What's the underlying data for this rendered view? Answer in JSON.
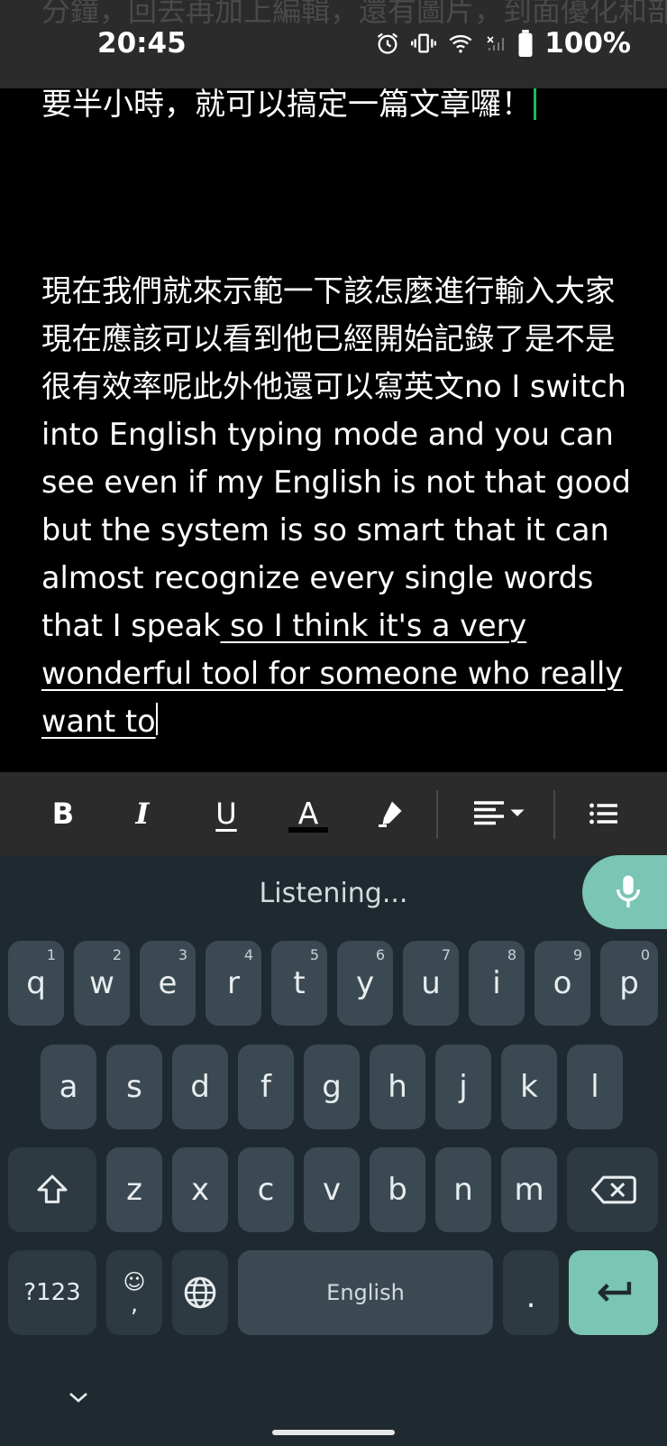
{
  "status_bar": {
    "time": "20:45",
    "battery": "100%",
    "background_text": "分鐘，回去再加上編輯，還有圖片，到面優化和部落格的工業…"
  },
  "document": {
    "paragraph1": "要半小時，就可以搞定一篇文章囉！",
    "paragraph2_plain": "現在我們就來示範一下該怎麼進行輸入大家現在應該可以看到他已經開始記錄了是不是很有效率呢此外他還可以寫英文no I switch into English typing mode and you can see even if my English is not that good but the system is so smart that it can almost recognize every single words that I speak",
    "paragraph2_composing": " so I think it's a very wonderful tool for someone who really want to"
  },
  "toolbar": {
    "bold_label": "B",
    "italic_label": "I",
    "underline_label": "U",
    "text_color_label": "A",
    "text_color_bar": "#000000",
    "icons": [
      "bold-icon",
      "italic-icon",
      "underline-icon",
      "text-color-icon",
      "highlight-icon",
      "align-icon",
      "list-icon"
    ]
  },
  "keyboard": {
    "status": "Listening...",
    "row1": [
      {
        "k": "q",
        "h": "1"
      },
      {
        "k": "w",
        "h": "2"
      },
      {
        "k": "e",
        "h": "3"
      },
      {
        "k": "r",
        "h": "4"
      },
      {
        "k": "t",
        "h": "5"
      },
      {
        "k": "y",
        "h": "6"
      },
      {
        "k": "u",
        "h": "7"
      },
      {
        "k": "i",
        "h": "8"
      },
      {
        "k": "o",
        "h": "9"
      },
      {
        "k": "p",
        "h": "0"
      }
    ],
    "row2": [
      "a",
      "s",
      "d",
      "f",
      "g",
      "h",
      "j",
      "k",
      "l"
    ],
    "row3": [
      "z",
      "x",
      "c",
      "v",
      "b",
      "n",
      "m"
    ],
    "symbols_label": "?123",
    "emoji_label": "☺",
    "comma_label": ",",
    "space_label": "English",
    "period_label": ".",
    "accent_color": "#7ac5b3"
  }
}
